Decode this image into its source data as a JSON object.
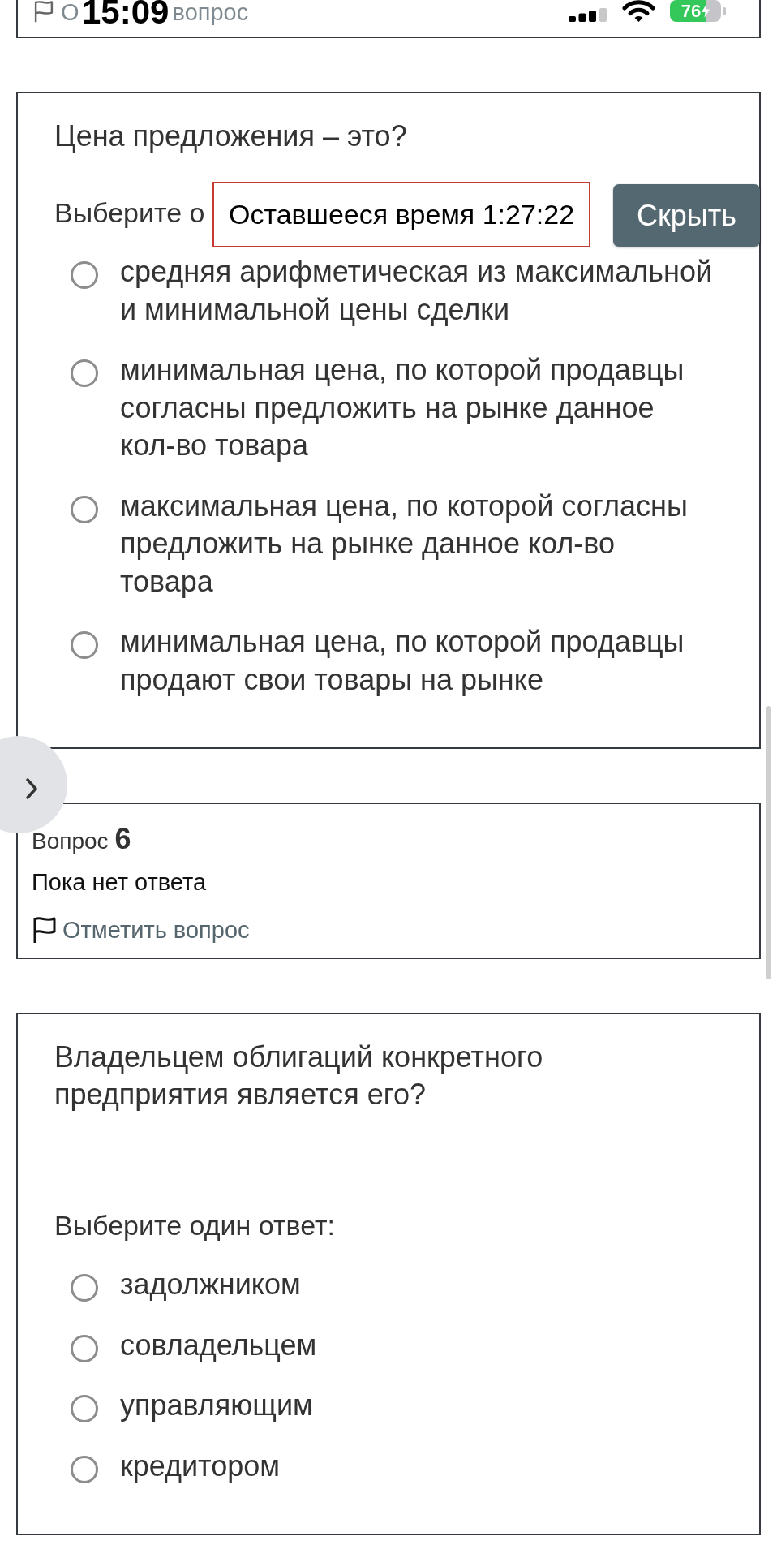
{
  "status_bar": {
    "time": "15:09",
    "battery": "76"
  },
  "top_card": {
    "flag_link_start": "О",
    "flag_link_end": "вопрос"
  },
  "timer": {
    "label": "Оставшееся время 1:27:22",
    "hide_button": "Скрыть"
  },
  "cards": [
    {
      "kind": "question",
      "text": "Цена предложения – это?",
      "prompt": "Выберите о",
      "options": [
        {
          "label": "средняя арифметическая из максимальной и минимальной цены сделки",
          "selected": false
        },
        {
          "label": "минимальная цена, по которой продавцы согласны предложить на рынке данное кол-во товара",
          "selected": false
        },
        {
          "label": "максимальная цена, по которой согласны предложить на рынке данное кол-во товара",
          "selected": false
        },
        {
          "label": "минимальная цена, по которой продавцы продают свои товары на рынке",
          "selected": false
        }
      ]
    },
    {
      "kind": "info",
      "label": "Вопрос",
      "number": "6",
      "status": "Пока нет ответа",
      "flag_link": "Отметить вопрос"
    },
    {
      "kind": "question",
      "text": "Владельцем облигаций конкретного предприятия является его?",
      "prompt": "Выберите один ответ:",
      "options": [
        {
          "label": "задолжником",
          "selected": false
        },
        {
          "label": "совладельцем",
          "selected": false
        },
        {
          "label": "управляющим",
          "selected": false
        },
        {
          "label": "кредитором",
          "selected": false
        }
      ]
    }
  ]
}
